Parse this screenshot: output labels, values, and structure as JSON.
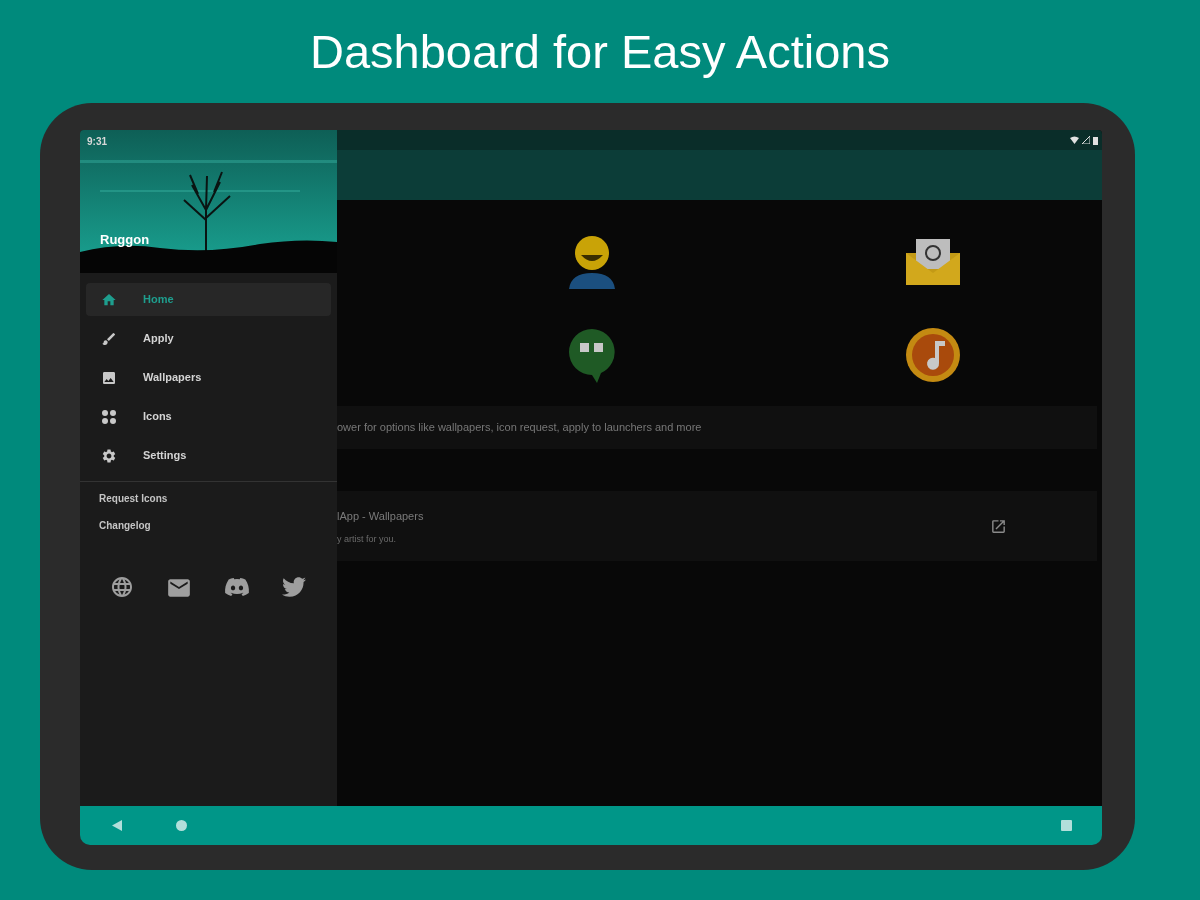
{
  "headline": "Dashboard for Easy Actions",
  "status_bar": {
    "time": "9:31"
  },
  "drawer": {
    "header": {
      "kind": "picture",
      "name": "Ruggon"
    },
    "items": [
      {
        "label": "Home",
        "selected": true
      },
      {
        "label": "Apply",
        "selected": false
      },
      {
        "label": "Wallpapers",
        "selected": false
      },
      {
        "label": "Icons",
        "selected": false
      },
      {
        "label": "Settings",
        "selected": false
      }
    ],
    "links": [
      "Request Icons",
      "Changelog"
    ]
  },
  "content": {
    "info_card": "ower for options like wallpapers, icon request, apply to launchers and more",
    "app_card": {
      "title": "lApp - Wallpapers",
      "subtitle": "y artist for you."
    }
  }
}
